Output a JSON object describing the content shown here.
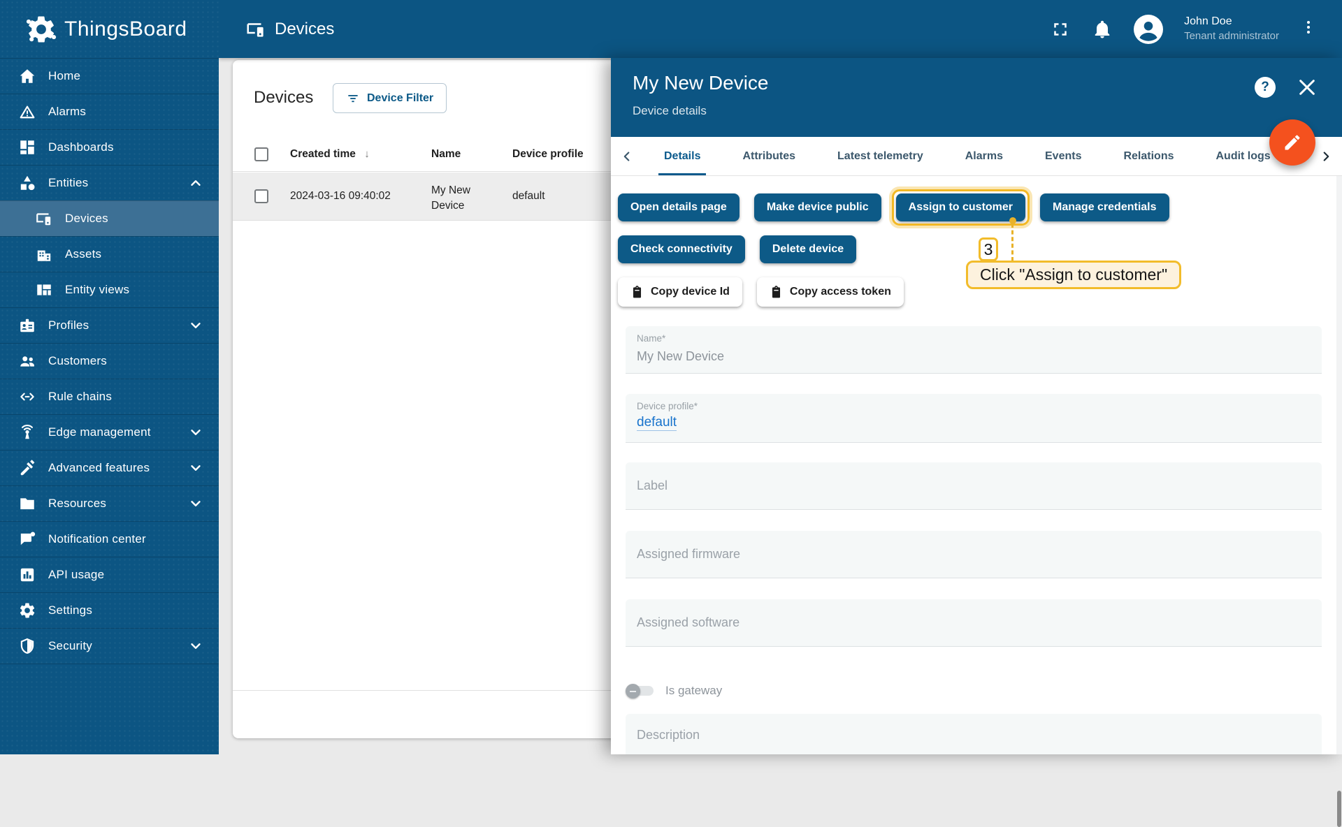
{
  "colors": {
    "primary": "#0c5583",
    "fab_accent": "#f4511e",
    "annotation_gold": "#f2bc2b",
    "link_blue": "#1873cc",
    "sidebar_selected": "#3d7095"
  },
  "app": {
    "name": "ThingsBoard"
  },
  "topbar": {
    "title": "Devices",
    "user": {
      "name": "John Doe",
      "role": "Tenant administrator"
    }
  },
  "sidebar": {
    "items": [
      {
        "label": "Home",
        "icon": "home-icon"
      },
      {
        "label": "Alarms",
        "icon": "alarms-icon"
      },
      {
        "label": "Dashboards",
        "icon": "dashboards-icon"
      },
      {
        "label": "Entities",
        "icon": "entities-icon",
        "expanded": true
      },
      {
        "label": "Devices",
        "icon": "devices-icon",
        "child": true,
        "active": true
      },
      {
        "label": "Assets",
        "icon": "assets-icon",
        "child": true
      },
      {
        "label": "Entity views",
        "icon": "entity-views-icon",
        "child": true
      },
      {
        "label": "Profiles",
        "icon": "profiles-icon",
        "expanded": false
      },
      {
        "label": "Customers",
        "icon": "customers-icon"
      },
      {
        "label": "Rule chains",
        "icon": "rule-chains-icon"
      },
      {
        "label": "Edge management",
        "icon": "edge-management-icon",
        "expanded": false
      },
      {
        "label": "Advanced features",
        "icon": "advanced-features-icon",
        "expanded": false
      },
      {
        "label": "Resources",
        "icon": "resources-icon",
        "expanded": false
      },
      {
        "label": "Notification center",
        "icon": "notification-center-icon"
      },
      {
        "label": "API usage",
        "icon": "api-usage-icon"
      },
      {
        "label": "Settings",
        "icon": "settings-icon"
      },
      {
        "label": "Security",
        "icon": "security-icon",
        "expanded": false
      }
    ]
  },
  "devices_card": {
    "title": "Devices",
    "filter_button_label": "Device Filter",
    "table": {
      "columns": {
        "created_time": "Created time",
        "name": "Name",
        "device_profile": "Device profile"
      },
      "sort_arrow": "↓",
      "rows": [
        {
          "created_time": "2024-03-16 09:40:02",
          "name": "My New Device",
          "device_profile": "default"
        }
      ]
    }
  },
  "panel": {
    "title": "My New Device",
    "subtitle": "Device details",
    "help_glyph": "?",
    "tabs": [
      {
        "label": "Details",
        "active": true
      },
      {
        "label": "Attributes"
      },
      {
        "label": "Latest telemetry"
      },
      {
        "label": "Alarms"
      },
      {
        "label": "Events"
      },
      {
        "label": "Relations"
      },
      {
        "label": "Audit logs"
      }
    ],
    "buttons_row1": [
      "Open details page",
      "Make device public",
      "Assign to customer",
      "Manage credentials"
    ],
    "buttons_row2": [
      "Check connectivity",
      "Delete device"
    ],
    "copy_buttons": [
      "Copy device Id",
      "Copy access token"
    ],
    "fields": {
      "name": {
        "label": "Name*",
        "value": "My New Device"
      },
      "device_profile": {
        "label": "Device profile*",
        "value": "default"
      },
      "label": {
        "placeholder": "Label"
      },
      "assigned_firmware": {
        "placeholder": "Assigned firmware"
      },
      "assigned_software": {
        "placeholder": "Assigned software"
      },
      "description": {
        "placeholder": "Description"
      }
    },
    "is_gateway": {
      "label": "Is gateway",
      "enabled": false
    }
  },
  "annotation": {
    "step": "3",
    "tooltip": "Click \"Assign to customer\""
  }
}
